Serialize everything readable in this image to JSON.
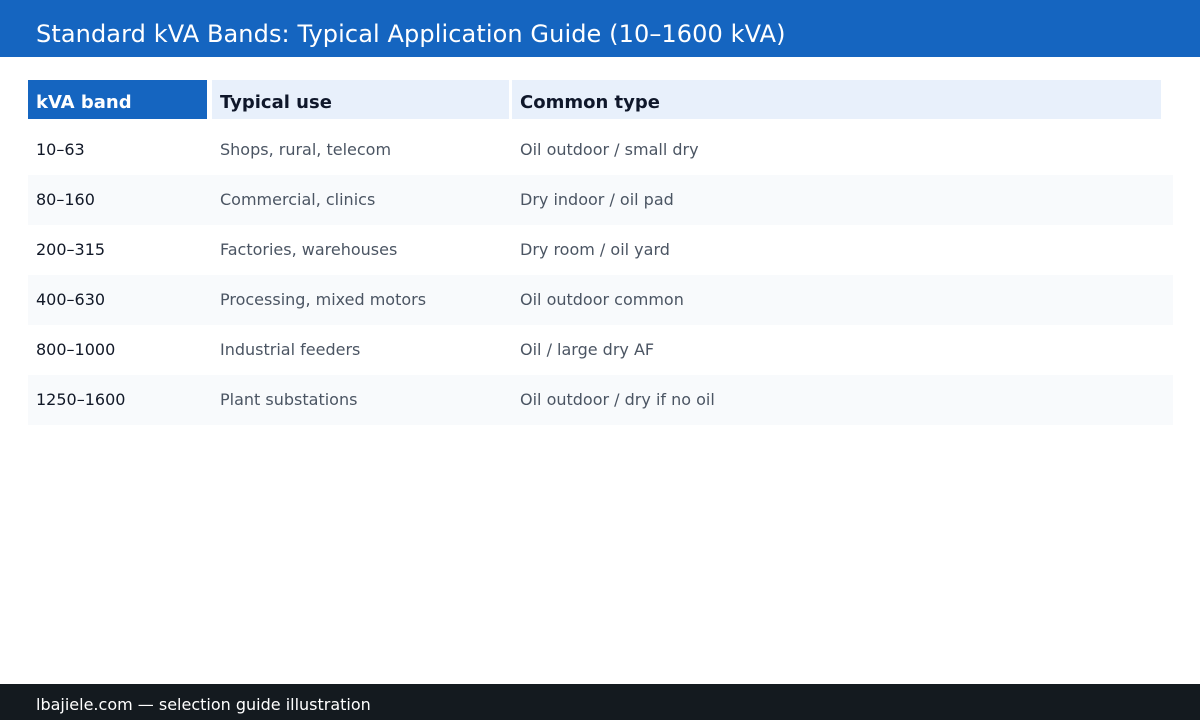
{
  "header": {
    "title": "Standard kVA Bands: Typical Application Guide (10–1600 kVA)"
  },
  "table": {
    "columns": [
      "kVA band",
      "Typical use",
      "Common type"
    ],
    "rows": [
      [
        "10–63",
        "Shops, rural, telecom",
        "Oil outdoor / small dry"
      ],
      [
        "80–160",
        "Commercial, clinics",
        "Dry indoor / oil pad"
      ],
      [
        "200–315",
        "Factories, warehouses",
        "Dry room / oil yard"
      ],
      [
        "400–630",
        "Processing, mixed motors",
        "Oil outdoor common"
      ],
      [
        "800–1000",
        "Industrial feeders",
        "Oil / large dry AF"
      ],
      [
        "1250–1600",
        "Plant substations",
        "Oil outdoor / dry if no oil"
      ]
    ]
  },
  "colors": {
    "accent": "#1565c0",
    "header_cell_bg": "#e8f0fb",
    "alt_row_bg": "#f8fafc",
    "footer_bg": "#141a1f"
  },
  "footer": {
    "text": "lbajiele.com — selection guide illustration"
  }
}
